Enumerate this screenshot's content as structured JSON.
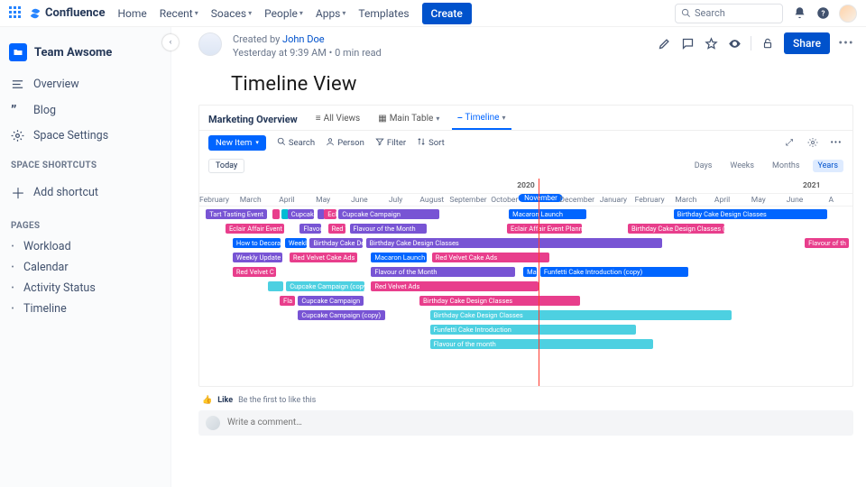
{
  "brand": "Confluence",
  "nav": [
    "Home",
    "Recent",
    "Soaces",
    "People",
    "Apps",
    "Templates"
  ],
  "nav_has_dropdown": [
    false,
    true,
    true,
    true,
    true,
    false
  ],
  "create": "Create",
  "search_placeholder": "Search",
  "sidebar": {
    "space": "Team Awsome",
    "items": [
      {
        "icon": "overview",
        "label": "Overview"
      },
      {
        "icon": "blog",
        "label": "Blog"
      },
      {
        "icon": "settings",
        "label": "Space Settings"
      }
    ],
    "shortcuts_label": "SPACE SHORTCUTS",
    "add_shortcut": "Add shortcut",
    "pages_label": "PAGES",
    "pages": [
      "Workload",
      "Calendar",
      "Activity Status",
      "Timeline"
    ]
  },
  "meta": {
    "created_by_prefix": "Created by ",
    "author": "John Doe",
    "subline": "Yesterday at 9:39 AM",
    "readtime": "0 min read"
  },
  "actions": {
    "share": "Share"
  },
  "page_title": "Timeline View",
  "db": {
    "title": "Marketing Overview",
    "views": [
      "All Views",
      "Main Table",
      "Timeline"
    ],
    "active_view": 2,
    "new_item": "New Item",
    "tools": [
      {
        "icon": "search",
        "label": "Search"
      },
      {
        "icon": "person",
        "label": "Person"
      },
      {
        "icon": "filter",
        "label": "Filter"
      },
      {
        "icon": "sort",
        "label": "Sort"
      }
    ],
    "today": "Today",
    "periods": [
      "Days",
      "Weeks",
      "Months",
      "Years"
    ],
    "active_period": 3
  },
  "timeline": {
    "years": [
      "",
      "2020",
      "2021"
    ],
    "months": [
      "February",
      "March",
      "April",
      "May",
      "June",
      "July",
      "August",
      "September",
      "October",
      "November",
      "December",
      "January",
      "February",
      "March",
      "April",
      "May",
      "June",
      "A"
    ],
    "highlight_month_index": 9,
    "playhead_pct": 51.9,
    "rows": [
      [
        {
          "label": "Tart Tasting Event",
          "start": 1.0,
          "w": 9.3,
          "color": "#7854d4"
        },
        {
          "label": "",
          "start": 11.2,
          "w": 0.9,
          "color": "#e83e8c"
        },
        {
          "label": "",
          "start": 12.6,
          "w": 0.6,
          "color": "#00bcd4"
        },
        {
          "label": "Cupcake",
          "start": 13.5,
          "w": 4.0,
          "color": "#7854d4"
        },
        {
          "label": "",
          "start": 18.1,
          "w": 0.7,
          "color": "#7854d4"
        },
        {
          "label": "Ecl",
          "start": 19.1,
          "w": 1.9,
          "color": "#e83e8c"
        },
        {
          "label": "Cupcake Campaign",
          "start": 21.3,
          "w": 15.4,
          "color": "#7854d4"
        },
        {
          "label": "Macaron Launch",
          "start": 47.4,
          "w": 11.8,
          "color": "#0065ff"
        },
        {
          "label": "Birthday Cake Design Classes",
          "start": 72.6,
          "w": 23.5,
          "color": "#0065ff"
        }
      ],
      [
        {
          "label": "Eclair Affair Event",
          "start": 4.0,
          "w": 9.0,
          "color": "#e83e8c"
        },
        {
          "label": "Flavou",
          "start": 15.4,
          "w": 3.3,
          "color": "#7854d4"
        },
        {
          "label": "Red V",
          "start": 19.7,
          "w": 2.7,
          "color": "#e83e8c"
        },
        {
          "label": "Flavour of the Month",
          "start": 23.0,
          "w": 11.8,
          "color": "#7854d4"
        },
        {
          "label": "Eclair Affair Event Planning",
          "start": 47.1,
          "w": 11.5,
          "color": "#e83e8c"
        },
        {
          "label": "Birthday Cake Design Classes (copy)",
          "start": 65.6,
          "w": 14.8,
          "color": "#e83e8c"
        }
      ],
      [
        {
          "label": "How to Decora",
          "start": 5.1,
          "w": 7.3,
          "color": "#0065ff"
        },
        {
          "label": "Weekl",
          "start": 13.1,
          "w": 3.3,
          "color": "#0065ff"
        },
        {
          "label": "Birthday Cake Desi",
          "start": 16.9,
          "w": 8.1,
          "color": "#7854d4"
        },
        {
          "label": "Birthday Cake Design Classes",
          "start": 25.5,
          "w": 45.3,
          "color": "#7854d4"
        },
        {
          "label": "Flavour of th",
          "start": 92.7,
          "w": 6.8,
          "color": "#e83e8c"
        }
      ],
      [
        {
          "label": "Weekly Update",
          "start": 5.1,
          "w": 7.6,
          "color": "#7854d4"
        },
        {
          "label": "Red Velvet Cake Ads",
          "start": 13.8,
          "w": 10.4,
          "color": "#e83e8c"
        },
        {
          "label": "Macaron Launch P",
          "start": 26.3,
          "w": 8.5,
          "color": "#0065ff"
        },
        {
          "label": "Red Velvet Cake Ads",
          "start": 35.6,
          "w": 18.0,
          "color": "#e83e8c"
        }
      ],
      [
        {
          "label": "Red Velvet C",
          "start": 5.1,
          "w": 6.7,
          "color": "#e83e8c"
        },
        {
          "label": "Flavour of the Month",
          "start": 26.3,
          "w": 22.0,
          "color": "#7854d4"
        },
        {
          "label": "Ma",
          "start": 49.6,
          "w": 2.1,
          "color": "#0065ff"
        },
        {
          "label": "Funfetti Cake Introduction (copy)",
          "start": 52.2,
          "w": 22.6,
          "color": "#0065ff"
        }
      ],
      [
        {
          "label": "",
          "start": 10.5,
          "w": 2.3,
          "color": "#4dd0e1"
        },
        {
          "label": "Cupcake Campaign (copy",
          "start": 13.3,
          "w": 12.0,
          "color": "#4dd0e1"
        },
        {
          "label": "Red Velvet Ads",
          "start": 26.3,
          "w": 25.7,
          "color": "#e83e8c"
        }
      ],
      [
        {
          "label": "Fla",
          "start": 12.3,
          "w": 2.3,
          "color": "#e83e8c"
        },
        {
          "label": "Cupcake Campaign",
          "start": 15.1,
          "w": 10.1,
          "color": "#7854d4"
        },
        {
          "label": "Birthday Cake Design Classes",
          "start": 33.7,
          "w": 24.6,
          "color": "#e83e8c"
        }
      ],
      [
        {
          "label": "Cupcake Campaign (copy)",
          "start": 15.1,
          "w": 13.3,
          "color": "#7854d4"
        },
        {
          "label": "Birthday Cake Design Classes",
          "start": 35.3,
          "w": 46.2,
          "color": "#4dd0e1"
        }
      ],
      [
        {
          "label": "Funfetti Cake Introduction",
          "start": 35.3,
          "w": 31.6,
          "color": "#4dd0e1"
        }
      ],
      [
        {
          "label": "Flavour of the month",
          "start": 35.3,
          "w": 34.2,
          "color": "#4dd0e1"
        }
      ]
    ]
  },
  "like": {
    "action": "Like",
    "text": "Be the first to like this"
  },
  "comment": {
    "placeholder": "Write a comment…"
  }
}
